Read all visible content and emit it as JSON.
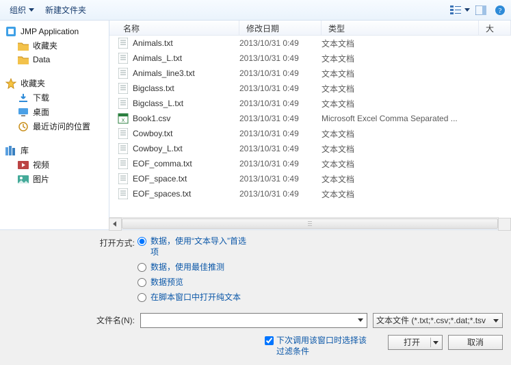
{
  "toolbar": {
    "organize": "组织",
    "new_folder": "新建文件夹"
  },
  "nav": {
    "root1": "JMP Application",
    "root1_children": [
      "收藏夹",
      "Data"
    ],
    "fav_label": "收藏夹",
    "fav_children": [
      "下载",
      "桌面",
      "最近访问的位置"
    ],
    "lib_label": "库",
    "lib_children": [
      "视频",
      "图片"
    ]
  },
  "columns": {
    "name": "名称",
    "date": "修改日期",
    "type": "类型",
    "size": "大"
  },
  "file_types": {
    "text": "文本文档",
    "csv": "Microsoft Excel Comma Separated ..."
  },
  "files": [
    {
      "name": "Animals.txt",
      "date": "2013/10/31 0:49",
      "type": "text"
    },
    {
      "name": "Animals_L.txt",
      "date": "2013/10/31 0:49",
      "type": "text"
    },
    {
      "name": "Animals_line3.txt",
      "date": "2013/10/31 0:49",
      "type": "text"
    },
    {
      "name": "Bigclass.txt",
      "date": "2013/10/31 0:49",
      "type": "text"
    },
    {
      "name": "Bigclass_L.txt",
      "date": "2013/10/31 0:49",
      "type": "text"
    },
    {
      "name": "Book1.csv",
      "date": "2013/10/31 0:49",
      "type": "csv"
    },
    {
      "name": "Cowboy.txt",
      "date": "2013/10/31 0:49",
      "type": "text"
    },
    {
      "name": "Cowboy_L.txt",
      "date": "2013/10/31 0:49",
      "type": "text"
    },
    {
      "name": "EOF_comma.txt",
      "date": "2013/10/31 0:49",
      "type": "text"
    },
    {
      "name": "EOF_space.txt",
      "date": "2013/10/31 0:49",
      "type": "text"
    },
    {
      "name": "EOF_spaces.txt",
      "date": "2013/10/31 0:49",
      "type": "text"
    }
  ],
  "open_mode": {
    "label": "打开方式:",
    "opt0": "数据，使用“文本导入”首选项",
    "opt1": "数据，使用最佳推测",
    "opt2": "数据预览",
    "opt3": "在脚本窗口中打开纯文本"
  },
  "filename_label": "文件名(N):",
  "filter_label": "文本文件 (*.txt;*.csv;*.dat;*.tsv",
  "remember_filter": "下次调用该窗口时选择该过滤条件",
  "open_button": "打开",
  "cancel_button": "取消"
}
